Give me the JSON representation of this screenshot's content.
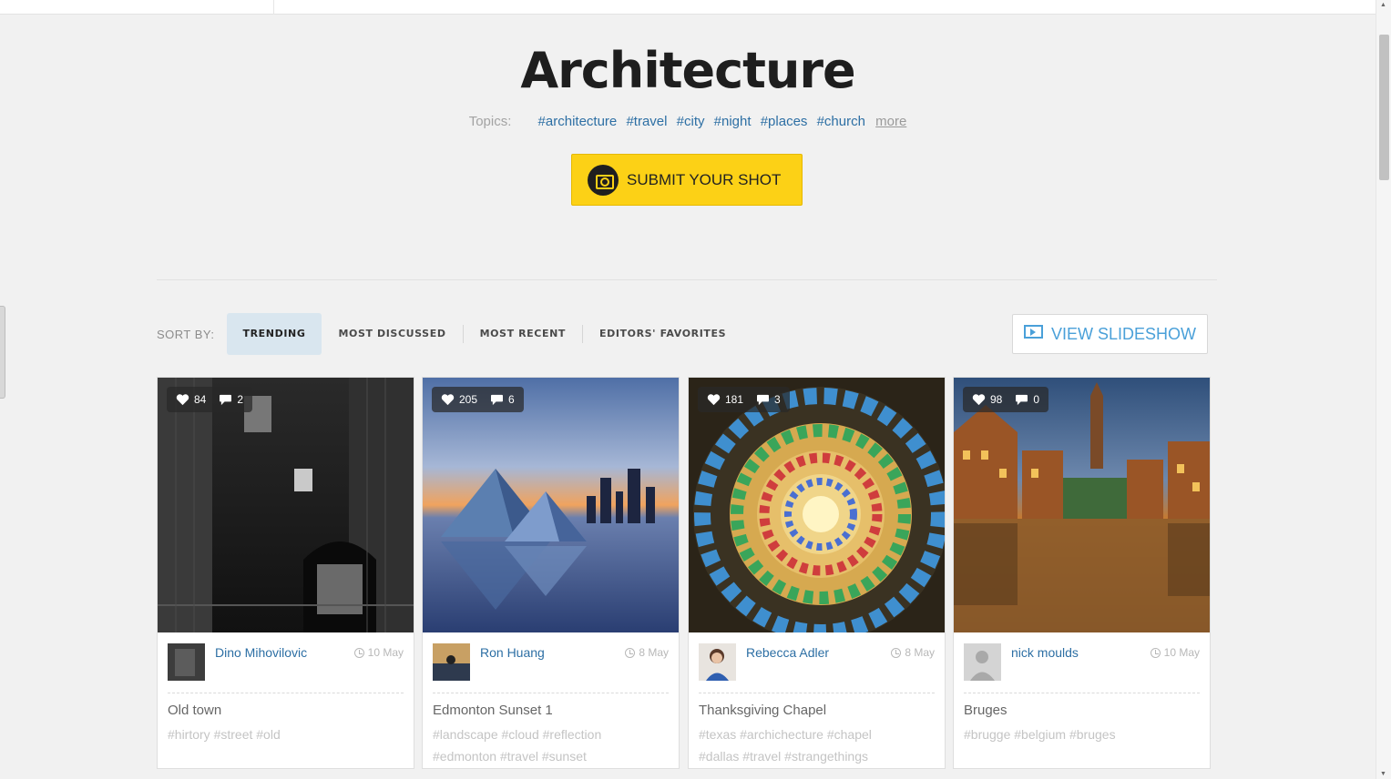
{
  "page": {
    "title": "Architecture",
    "topics_label": "Topics:",
    "topics": [
      "#architecture",
      "#travel",
      "#city",
      "#night",
      "#places",
      "#church"
    ],
    "more_label": "more",
    "submit_label": "SUBMIT YOUR SHOT"
  },
  "sort": {
    "label": "SORT BY:",
    "options": [
      "TRENDING",
      "MOST DISCUSSED",
      "MOST RECENT",
      "EDITORS' FAVORITES"
    ],
    "active": "TRENDING"
  },
  "slideshow_label": "VIEW SLIDESHOW",
  "cards": [
    {
      "likes": "84",
      "comments": "2",
      "author": "Dino Mihovilovic",
      "date": "10 May",
      "title": "Old town",
      "tags_line1": "#hirtory #street #old",
      "tags_line2": ""
    },
    {
      "likes": "205",
      "comments": "6",
      "author": "Ron Huang",
      "date": "8 May",
      "title": "Edmonton Sunset 1",
      "tags_line1": "#landscape #cloud #reflection",
      "tags_line2": "#edmonton #travel #sunset"
    },
    {
      "likes": "181",
      "comments": "3",
      "author": "Rebecca Adler",
      "date": "8 May",
      "title": "Thanksgiving Chapel",
      "tags_line1": "#texas #archichecture #chapel",
      "tags_line2": "#dallas #travel #strangethings"
    },
    {
      "likes": "98",
      "comments": "0",
      "author": "nick moulds",
      "date": "10 May",
      "title": "Bruges",
      "tags_line1": "#brugge #belgium #bruges",
      "tags_line2": ""
    }
  ],
  "colors": {
    "accent_yellow": "#fcd116",
    "link_blue": "#2d6fa4",
    "slideshow_blue": "#4aa0d9",
    "active_sort_bg": "#d9e6ef"
  },
  "icons": {
    "likes": "heart-icon",
    "comments": "comment-icon",
    "date": "clock-icon",
    "submit": "camera-icon",
    "slideshow": "slideshow-icon"
  }
}
